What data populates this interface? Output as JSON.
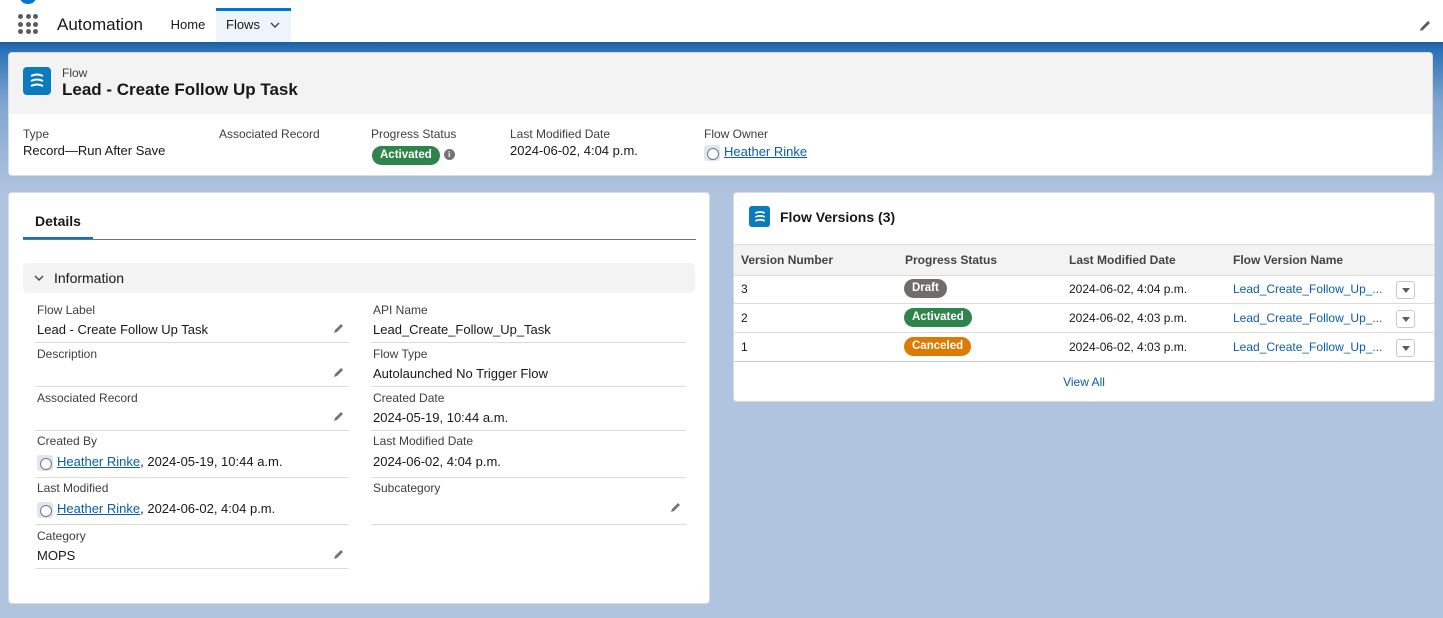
{
  "nav": {
    "app_name": "Automation",
    "tabs": [
      {
        "label": "Home"
      },
      {
        "label": "Flows"
      }
    ]
  },
  "header": {
    "object": "Flow",
    "title": "Lead - Create Follow Up Task",
    "fields": {
      "type": {
        "label": "Type",
        "value": "Record—Run After Save"
      },
      "associated_record": {
        "label": "Associated Record",
        "value": ""
      },
      "progress_status": {
        "label": "Progress Status",
        "value": "Activated"
      },
      "last_modified_date": {
        "label": "Last Modified Date",
        "value": "2024-06-02, 4:04 p.m."
      },
      "flow_owner": {
        "label": "Flow Owner",
        "value": "Heather Rinke"
      }
    }
  },
  "details": {
    "tab": "Details",
    "section": "Information",
    "left": [
      {
        "label": "Flow Label",
        "value": "Lead - Create Follow Up Task"
      },
      {
        "label": "Description",
        "value": ""
      },
      {
        "label": "Associated Record",
        "value": ""
      },
      {
        "label": "Created By",
        "user": "Heather Rinke",
        "value": ", 2024-05-19, 10:44 a.m."
      },
      {
        "label": "Last Modified",
        "user": "Heather Rinke",
        "value": ", 2024-06-02, 4:04 p.m."
      },
      {
        "label": "Category",
        "value": "MOPS"
      }
    ],
    "right": [
      {
        "label": "API Name",
        "value": "Lead_Create_Follow_Up_Task"
      },
      {
        "label": "Flow Type",
        "value": "Autolaunched No Trigger Flow"
      },
      {
        "label": "Created Date",
        "value": "2024-05-19, 10:44 a.m."
      },
      {
        "label": "Last Modified Date",
        "value": "2024-06-02, 4:04 p.m."
      },
      {
        "label": "Subcategory",
        "value": ""
      }
    ]
  },
  "versions": {
    "title": "Flow Versions (3)",
    "columns": [
      "Version Number",
      "Progress Status",
      "Last Modified Date",
      "Flow Version Name"
    ],
    "rows": [
      {
        "number": "3",
        "status": "Draft",
        "modified": "2024-06-02, 4:04 p.m.",
        "name": "Lead_Create_Follow_Up_..."
      },
      {
        "number": "2",
        "status": "Activated",
        "modified": "2024-06-02, 4:03 p.m.",
        "name": "Lead_Create_Follow_Up_..."
      },
      {
        "number": "1",
        "status": "Canceled",
        "modified": "2024-06-02, 4:03 p.m.",
        "name": "Lead_Create_Follow_Up_..."
      }
    ],
    "view_all": "View All"
  },
  "colors": {
    "brand": "#0176d3",
    "activated": "#2e844a",
    "draft": "#706e6b",
    "canceled": "#dd7a01"
  }
}
